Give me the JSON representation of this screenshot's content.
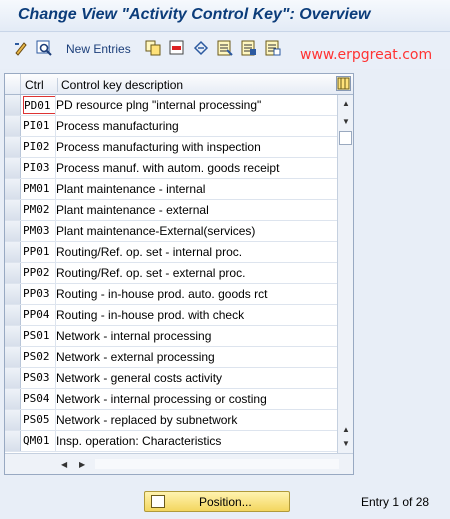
{
  "window": {
    "title": "Change View \"Activity Control Key\": Overview"
  },
  "toolbar": {
    "new_entries": "New Entries",
    "icons": [
      "change-display-icon",
      "find-icon",
      "copy-icon",
      "delete-icon",
      "undo-icon",
      "select-all-icon",
      "select-block-icon",
      "deselect-all-icon"
    ]
  },
  "watermark": "www.erpgreat.com",
  "table": {
    "headers": {
      "ctrl": "Ctrl",
      "desc": "Control key description"
    },
    "rows": [
      {
        "ctrl": "PD01",
        "desc": "PD resource plng \"internal processing\""
      },
      {
        "ctrl": "PI01",
        "desc": "Process manufacturing"
      },
      {
        "ctrl": "PI02",
        "desc": "Process manufacturing with inspection"
      },
      {
        "ctrl": "PI03",
        "desc": "Process manuf. with autom. goods receipt"
      },
      {
        "ctrl": "PM01",
        "desc": "Plant maintenance - internal"
      },
      {
        "ctrl": "PM02",
        "desc": "Plant maintenance - external"
      },
      {
        "ctrl": "PM03",
        "desc": "Plant maintenance-External(services)"
      },
      {
        "ctrl": "PP01",
        "desc": "Routing/Ref. op. set - internal proc."
      },
      {
        "ctrl": "PP02",
        "desc": "Routing/Ref. op. set - external proc."
      },
      {
        "ctrl": "PP03",
        "desc": "Routing - in-house prod. auto. goods rct"
      },
      {
        "ctrl": "PP04",
        "desc": "Routing - in-house prod. with check"
      },
      {
        "ctrl": "PS01",
        "desc": "Network - internal processing"
      },
      {
        "ctrl": "PS02",
        "desc": "Network - external processing"
      },
      {
        "ctrl": "PS03",
        "desc": "Network - general costs activity"
      },
      {
        "ctrl": "PS04",
        "desc": "Network - internal processing or costing"
      },
      {
        "ctrl": "PS05",
        "desc": "Network - replaced by subnetwork"
      },
      {
        "ctrl": "QM01",
        "desc": "Insp. operation: Characteristics"
      }
    ]
  },
  "footer": {
    "position_button": "Position...",
    "entry_info": "Entry 1 of 28"
  }
}
